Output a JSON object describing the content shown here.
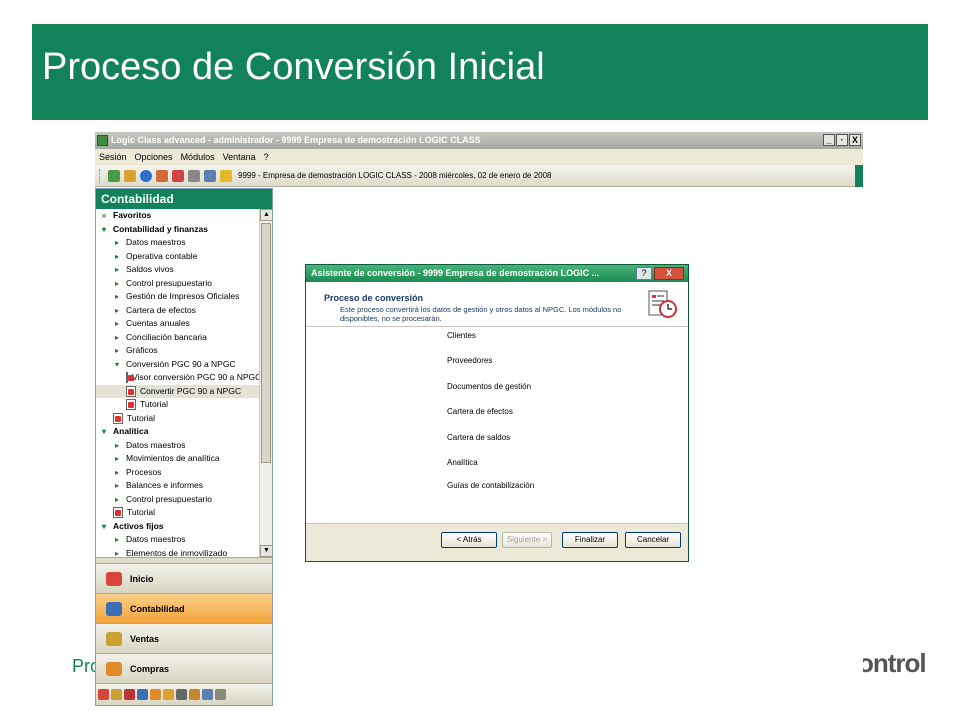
{
  "slide": {
    "title": "Proceso de Conversión Inicial",
    "footer_left": "Pro",
    "footer_right": "ontrol"
  },
  "app": {
    "title": "Logic Class advanced - administrador - 9999 Empresa de demostración LOGIC CLASS",
    "window_buttons": [
      "_",
      "·",
      "X"
    ],
    "menu": [
      "Sesión",
      "Opciones",
      "Módulos",
      "Ventana",
      "?"
    ],
    "toolbar_text": "9999 - Empresa de demostración LOGIC CLASS - 2008    miércoles, 02 de enero de 2008"
  },
  "nav": {
    "header": "Contabilidad",
    "tree": [
      {
        "label": "Favoritos",
        "level": 0,
        "type": "group",
        "expanded": false
      },
      {
        "label": "Contabilidad y finanzas",
        "level": 0,
        "type": "group",
        "expanded": true
      },
      {
        "label": "Datos maestros",
        "level": 1,
        "type": "item"
      },
      {
        "label": "Operativa contable",
        "level": 1,
        "type": "item"
      },
      {
        "label": "Saldos vivos",
        "level": 1,
        "type": "item"
      },
      {
        "label": "Control presupuestario",
        "level": 1,
        "type": "item"
      },
      {
        "label": "Gestión de Impresos Oficiales",
        "level": 1,
        "type": "item"
      },
      {
        "label": "Cartera de efectos",
        "level": 1,
        "type": "item"
      },
      {
        "label": "Cuentas anuales",
        "level": 1,
        "type": "item"
      },
      {
        "label": "Conciliación bancaria",
        "level": 1,
        "type": "item"
      },
      {
        "label": "Gráficos",
        "level": 1,
        "type": "item"
      },
      {
        "label": "Conversión PGC 90 a NPGC",
        "level": 1,
        "type": "folder-open"
      },
      {
        "label": "Visor conversión PGC 90 a NPGC",
        "level": 2,
        "type": "doc"
      },
      {
        "label": "Convertir PGC 90 a NPGC",
        "level": 2,
        "type": "doc",
        "selected": true
      },
      {
        "label": "Tutorial",
        "level": 2,
        "type": "doc"
      },
      {
        "label": "Tutorial",
        "level": 1,
        "type": "doc"
      },
      {
        "label": "Analítica",
        "level": 0,
        "type": "group",
        "expanded": true
      },
      {
        "label": "Datos maestros",
        "level": 1,
        "type": "item"
      },
      {
        "label": "Movimientos de analítica",
        "level": 1,
        "type": "item"
      },
      {
        "label": "Procesos",
        "level": 1,
        "type": "item"
      },
      {
        "label": "Balances e informes",
        "level": 1,
        "type": "item"
      },
      {
        "label": "Control presupuestario",
        "level": 1,
        "type": "item"
      },
      {
        "label": "Tutorial",
        "level": 1,
        "type": "doc"
      },
      {
        "label": "Activos fijos",
        "level": 0,
        "type": "group",
        "expanded": true
      },
      {
        "label": "Datos maestros",
        "level": 1,
        "type": "item"
      },
      {
        "label": "Elementos de inmovilizado",
        "level": 1,
        "type": "item"
      }
    ],
    "modules": [
      {
        "label": "Inicio",
        "active": false,
        "color": "#d8453a"
      },
      {
        "label": "Contabilidad",
        "active": true,
        "color": "#3b6fb5"
      },
      {
        "label": "Ventas",
        "active": false,
        "color": "#c8a130"
      },
      {
        "label": "Compras",
        "active": false,
        "color": "#e08a2a"
      }
    ]
  },
  "dialog": {
    "title": "Asistente de conversión - 9999 Empresa de demostración LOGIC ...",
    "help": "?",
    "close": "X",
    "heading": "Proceso de conversión",
    "description": "Este proceso convertirá los datos de gestión y otros datos al NPGC. Los módulos no disponibles, no se procesarán.",
    "steps": [
      "Clientes",
      "Proveedores",
      "Documentos de gestión",
      "Cartera de efectos",
      "Cartera de saldos",
      "Analítica",
      "Guías de contabilización"
    ],
    "buttons": {
      "back": "< Atrás",
      "next": "Siguiente >",
      "finish": "Finalizar",
      "cancel": "Cancelar"
    }
  }
}
